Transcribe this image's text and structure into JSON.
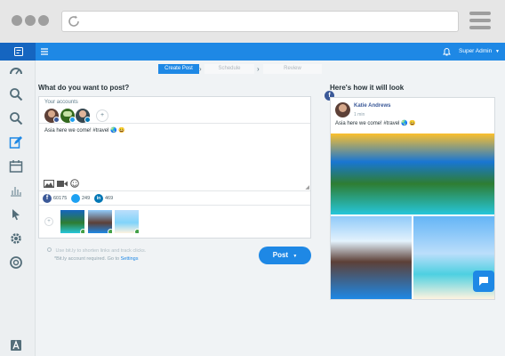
{
  "topbar": {
    "user_name": "Super Admin"
  },
  "stepper": {
    "steps": [
      "Create Post",
      "Schedule",
      "Review"
    ]
  },
  "composer": {
    "heading": "What do you want to post?",
    "accounts_label": "Your accounts",
    "add_label": "+",
    "message": "Asia here we come! #travel 🌏 😀",
    "stats": [
      {
        "network": "facebook",
        "count": "60175"
      },
      {
        "network": "twitter",
        "count": "249"
      },
      {
        "network": "linkedin",
        "count": "469"
      }
    ],
    "shorten_option": "Use bit.ly to shorten links and track clicks.",
    "bitly_note": "*Bit.ly account required. Go to",
    "settings_link": "Settings",
    "post_button": "Post"
  },
  "preview": {
    "heading": "Here's how it will look",
    "author": "Katie Andrews",
    "time": "1 min",
    "message": "Asia here we come! #travel 🌏 😀"
  },
  "colors": {
    "primary": "#1e88e5",
    "facebook": "#3b5998",
    "twitter": "#1da1f2",
    "linkedin": "#0077b5"
  }
}
